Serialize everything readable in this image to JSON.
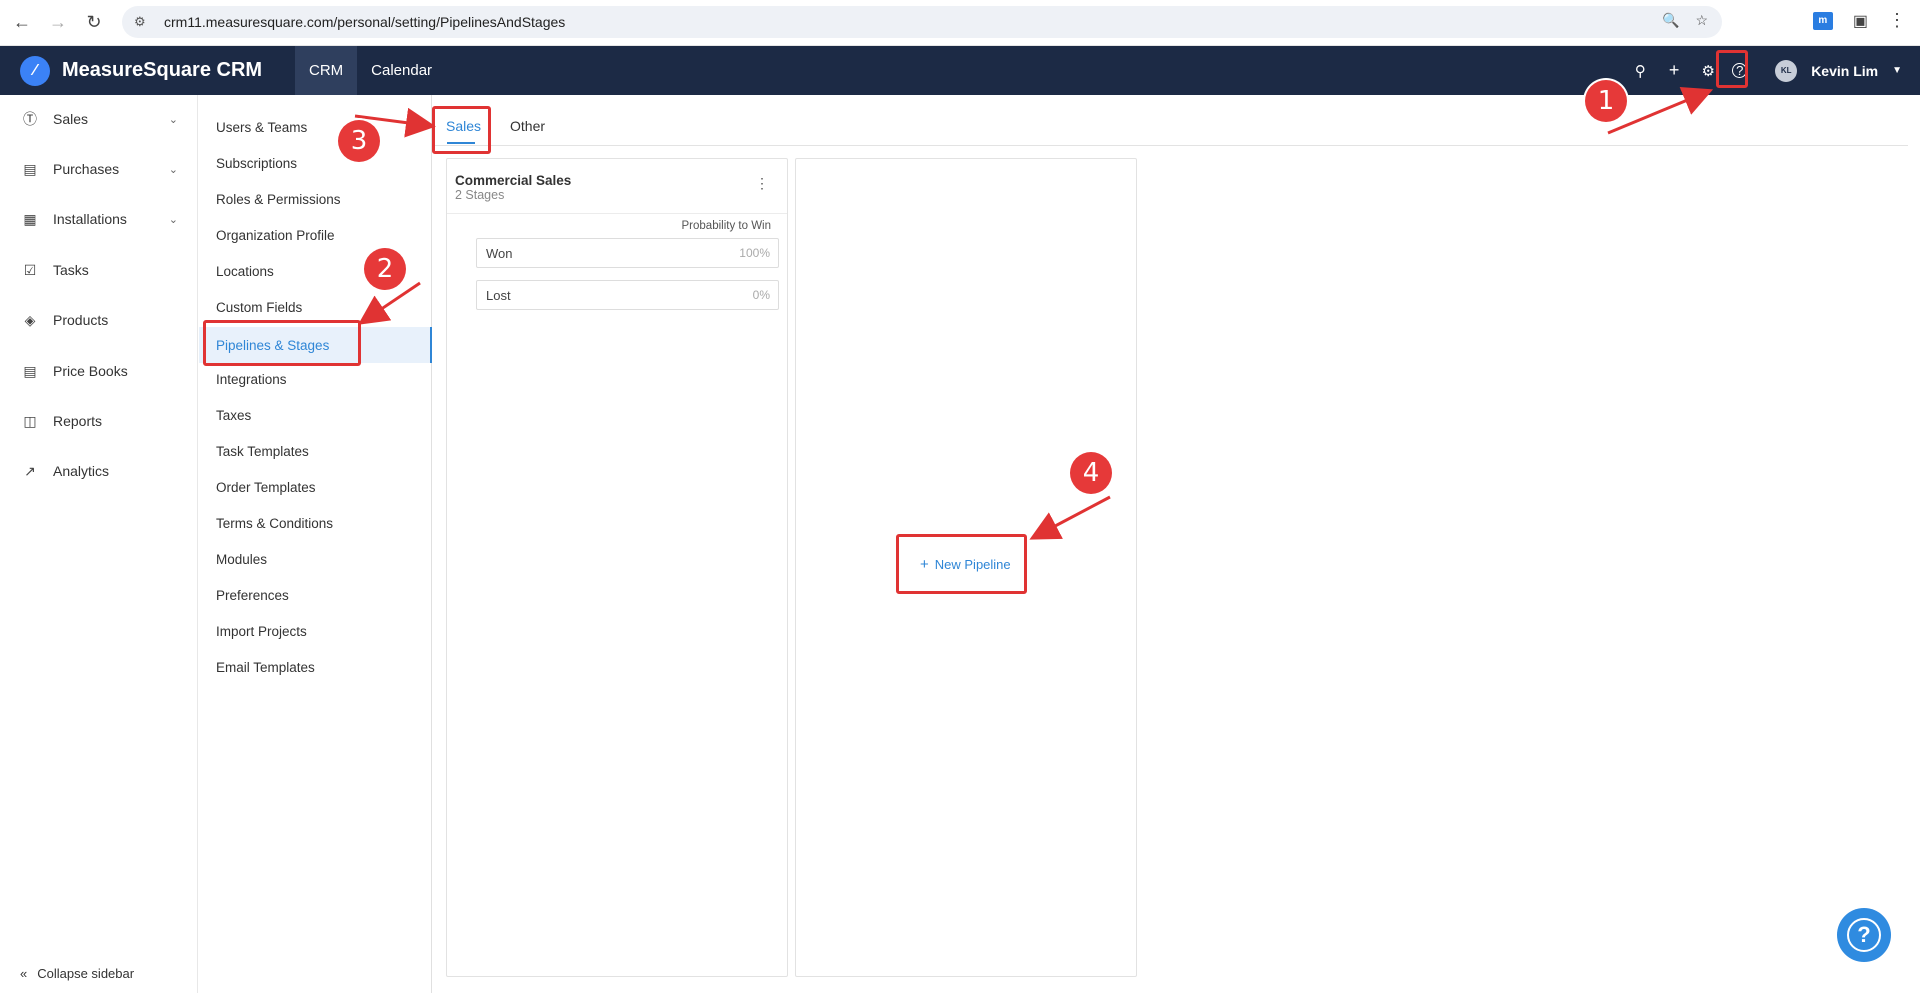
{
  "browser": {
    "url": "crm11.measuresquare.com/personal/setting/PipelinesAndStages"
  },
  "header": {
    "app_name": "MeasureSquare CRM",
    "tabs": [
      {
        "label": "CRM",
        "active": true
      },
      {
        "label": "Calendar",
        "active": false
      }
    ],
    "user": {
      "initials": "KL",
      "name": "Kevin Lim"
    }
  },
  "sidebar": {
    "items": [
      {
        "label": "Sales",
        "icon": "dollar-icon",
        "has_chevron": true
      },
      {
        "label": "Purchases",
        "icon": "purchases-icon",
        "has_chevron": true
      },
      {
        "label": "Installations",
        "icon": "installations-icon",
        "has_chevron": true
      },
      {
        "label": "Tasks",
        "icon": "tasks-icon",
        "has_chevron": false
      },
      {
        "label": "Products",
        "icon": "box-icon",
        "has_chevron": false
      },
      {
        "label": "Price Books",
        "icon": "book-icon",
        "has_chevron": false
      },
      {
        "label": "Reports",
        "icon": "reports-icon",
        "has_chevron": false
      },
      {
        "label": "Analytics",
        "icon": "analytics-icon",
        "has_chevron": false
      }
    ],
    "collapse_label": "Collapse sidebar"
  },
  "settings_menu": {
    "items": [
      "Users & Teams",
      "Subscriptions",
      "Roles & Permissions",
      "Organization Profile",
      "Locations",
      "Custom Fields",
      "Pipelines & Stages",
      "Integrations",
      "Taxes",
      "Task Templates",
      "Order Templates",
      "Terms & Conditions",
      "Modules",
      "Preferences",
      "Import Projects",
      "Email Templates"
    ],
    "active": "Pipelines & Stages"
  },
  "main": {
    "tabs": [
      {
        "label": "Sales",
        "active": true
      },
      {
        "label": "Other",
        "active": false
      }
    ],
    "pipeline": {
      "title": "Commercial Sales",
      "subtitle": "2 Stages",
      "prob_label": "Probability to Win",
      "stages": [
        {
          "name": "Won",
          "pct": "100%"
        },
        {
          "name": "Lost",
          "pct": "0%"
        }
      ]
    },
    "new_pipeline_label": "New Pipeline"
  },
  "annotations": {
    "badges": [
      "1",
      "2",
      "3",
      "4"
    ],
    "color": "#e03333"
  }
}
